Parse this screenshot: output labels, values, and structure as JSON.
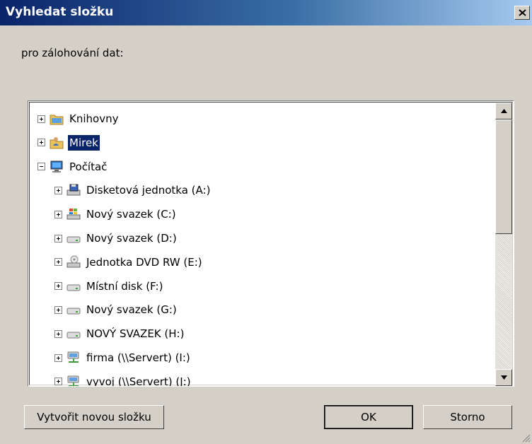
{
  "dialog": {
    "title": "Vyhledat složku",
    "close_label": "close",
    "prompt": "pro zálohování dat:"
  },
  "tree": {
    "items": [
      {
        "label": "Knihovny",
        "icon": "libraries-folder-icon",
        "level": 0,
        "expander": "plus",
        "selected": false
      },
      {
        "label": "Mirek",
        "icon": "user-folder-icon",
        "level": 0,
        "expander": "plus",
        "selected": true
      },
      {
        "label": "Počítač",
        "icon": "computer-icon",
        "level": 0,
        "expander": "minus",
        "selected": false
      },
      {
        "label": "Disketová jednotka (A:)",
        "icon": "floppy-drive-icon",
        "level": 1,
        "expander": "plus",
        "selected": false
      },
      {
        "label": "Nový svazek (C:)",
        "icon": "windows-drive-icon",
        "level": 1,
        "expander": "plus",
        "selected": false
      },
      {
        "label": "Nový svazek (D:)",
        "icon": "hard-drive-icon",
        "level": 1,
        "expander": "plus",
        "selected": false
      },
      {
        "label": "Jednotka DVD RW (E:)",
        "icon": "dvd-drive-icon",
        "level": 1,
        "expander": "plus",
        "selected": false
      },
      {
        "label": "Místní disk (F:)",
        "icon": "hard-drive-icon",
        "level": 1,
        "expander": "plus",
        "selected": false
      },
      {
        "label": "Nový svazek (G:)",
        "icon": "hard-drive-icon",
        "level": 1,
        "expander": "plus",
        "selected": false
      },
      {
        "label": "NOVÝ SVAZEK (H:)",
        "icon": "hard-drive-icon",
        "level": 1,
        "expander": "plus",
        "selected": false
      },
      {
        "label": "firma (\\\\Servert) (I:)",
        "icon": "network-drive-icon",
        "level": 1,
        "expander": "plus",
        "selected": false
      },
      {
        "label": "vyvoj (\\\\Servert) (J:)",
        "icon": "network-drive-icon",
        "level": 1,
        "expander": "plus",
        "selected": false
      }
    ]
  },
  "buttons": {
    "new_folder": "Vytvořit novou složku",
    "ok": "OK",
    "cancel": "Storno"
  },
  "colors": {
    "selection": "#0a246a",
    "title_start": "#0a246a",
    "title_end": "#a6caf0"
  }
}
